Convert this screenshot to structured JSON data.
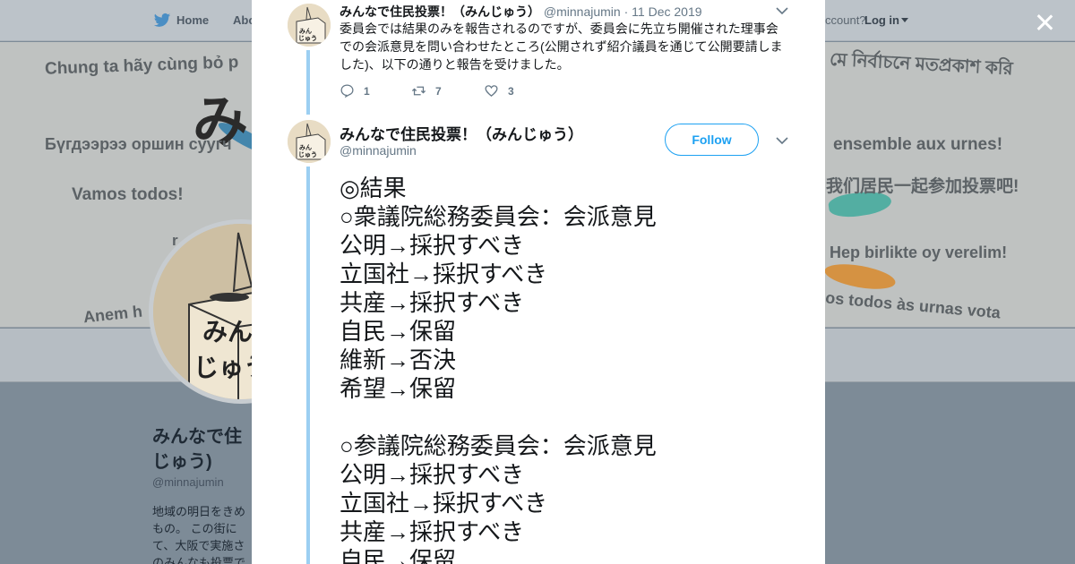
{
  "background": {
    "nav": {
      "home": "Home",
      "about": "Abo",
      "account_prompt": "ccount?",
      "login": "Log in"
    },
    "banner_texts": [
      "Chung ta hãy cùng bỏ p",
      "み",
      "Бүгдээрээ оршин суугч",
      "Vamos todos!",
      "r",
      "Anem h",
      "মে নির্বাচনে মতপ্রকাশ করি",
      "!",
      "ensemble aux urnes!",
      "我们居民一起参加投票吧!",
      "Hep birlikte oy verelim!",
      "os todos às urnas vota"
    ],
    "avatar_text": [
      "みん",
      "じゅう"
    ],
    "profile": {
      "name": "みんなで住じゅう)",
      "handle": "@minnajumin",
      "bio": "地域の明日をきめもの。 この街にて、大阪で実施さのみんなも投票で"
    }
  },
  "tweet1": {
    "name": "みんなで住民投票！（みんじゅう）",
    "handle": "@minnajumin",
    "separator": "·",
    "date": "11 Dec 2019",
    "text": "委員会では結果のみを報告されるのですが、委員会に先立ち開催された理事会での会派意見を問い合わせたところ(公開されず紹介議員を通じて公開要請しました)、以下の通りと報告を受けました。",
    "replies": "1",
    "retweets": "7",
    "likes": "3"
  },
  "tweet2": {
    "name": "みんなで住民投票！（みんじゅう）",
    "handle": "@minnajumin",
    "follow_label": "Follow",
    "lines": [
      "◎結果",
      "○衆議院総務委員会：会派意見",
      "公明→採択すべき",
      "立国社→採択すべき",
      "共産→採択すべき",
      "自民→保留",
      "維新→否決",
      "希望→保留",
      "",
      "○参議院総務委員会：会派意見",
      "公明→採択すべき",
      "立国社→採択すべき",
      "共産→採択すべき",
      "自民→保留"
    ]
  },
  "colors": {
    "twitter_blue": "#1da1f2",
    "thread_line": "#9ccff2",
    "overlay": "#7d8b97"
  }
}
